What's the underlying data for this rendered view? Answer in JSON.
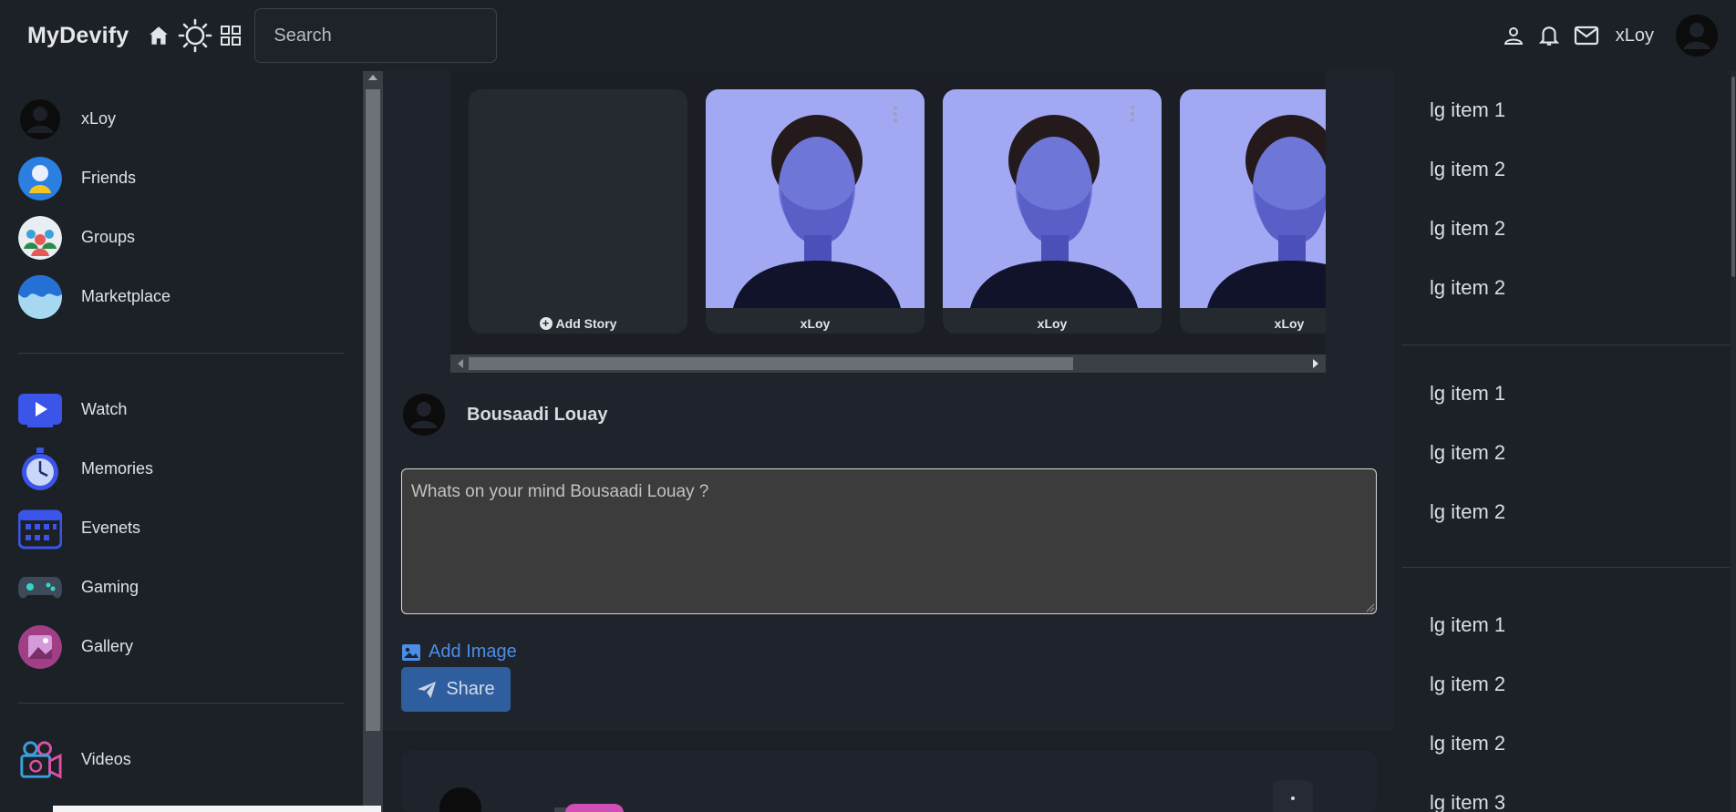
{
  "header": {
    "brand": "MyDevify",
    "search_placeholder": "Search",
    "username": "xLoy"
  },
  "sidebar": {
    "groups": [
      [
        {
          "label": "xLoy",
          "icon": "user-avatar-icon"
        },
        {
          "label": "Friends",
          "icon": "friends-icon"
        },
        {
          "label": "Groups",
          "icon": "groups-icon"
        },
        {
          "label": "Marketplace",
          "icon": "marketplace-icon"
        }
      ],
      [
        {
          "label": "Watch",
          "icon": "watch-icon"
        },
        {
          "label": "Memories",
          "icon": "memories-icon"
        },
        {
          "label": "Evenets",
          "icon": "events-icon"
        },
        {
          "label": "Gaming",
          "icon": "gaming-icon"
        },
        {
          "label": "Gallery",
          "icon": "gallery-icon"
        }
      ],
      [
        {
          "label": "Videos",
          "icon": "videos-icon"
        }
      ]
    ]
  },
  "stories": {
    "add_label": "Add Story",
    "items": [
      {
        "name": "xLoy"
      },
      {
        "name": "xLoy"
      },
      {
        "name": "xLoy"
      }
    ]
  },
  "composer": {
    "author": "Bousaadi Louay",
    "placeholder": "Whats on your mind Bousaadi Louay ?",
    "add_image_label": "Add Image",
    "share_label": "Share"
  },
  "right_panel": {
    "groups": [
      [
        "lg item 1",
        "lg item 2",
        "lg item 2",
        "lg item 2"
      ],
      [
        "lg item 1",
        "lg item 2",
        "lg item 2"
      ],
      [
        "lg item 1",
        "lg item 2",
        "lg item 2",
        "lg item 3"
      ]
    ]
  },
  "colors": {
    "background": "#1e222a",
    "panel": "#1c2027",
    "accent_link": "#4a8ee8",
    "share_button": "#2f5e9e"
  }
}
